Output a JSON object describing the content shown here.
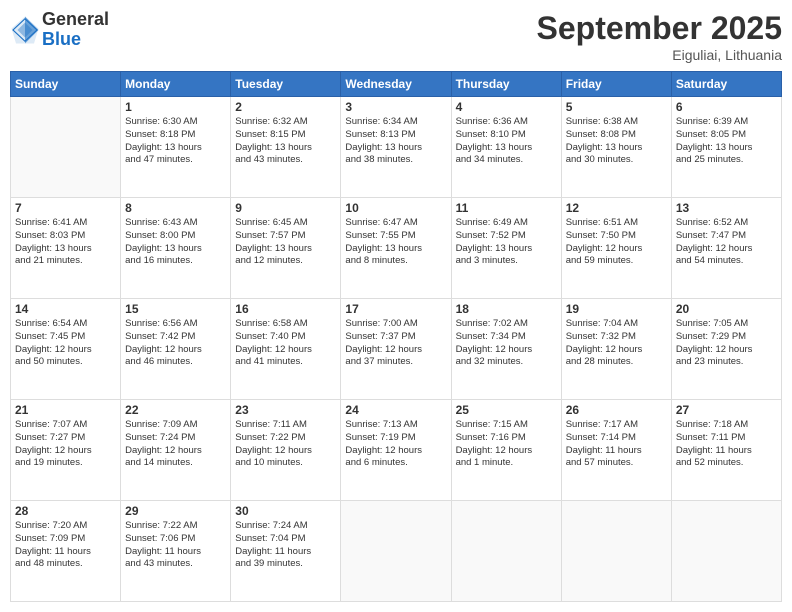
{
  "header": {
    "logo_general": "General",
    "logo_blue": "Blue",
    "month_title": "September 2025",
    "location": "Eiguliai, Lithuania"
  },
  "days_of_week": [
    "Sunday",
    "Monday",
    "Tuesday",
    "Wednesday",
    "Thursday",
    "Friday",
    "Saturday"
  ],
  "weeks": [
    [
      {
        "day": "",
        "info": ""
      },
      {
        "day": "1",
        "info": "Sunrise: 6:30 AM\nSunset: 8:18 PM\nDaylight: 13 hours\nand 47 minutes."
      },
      {
        "day": "2",
        "info": "Sunrise: 6:32 AM\nSunset: 8:15 PM\nDaylight: 13 hours\nand 43 minutes."
      },
      {
        "day": "3",
        "info": "Sunrise: 6:34 AM\nSunset: 8:13 PM\nDaylight: 13 hours\nand 38 minutes."
      },
      {
        "day": "4",
        "info": "Sunrise: 6:36 AM\nSunset: 8:10 PM\nDaylight: 13 hours\nand 34 minutes."
      },
      {
        "day": "5",
        "info": "Sunrise: 6:38 AM\nSunset: 8:08 PM\nDaylight: 13 hours\nand 30 minutes."
      },
      {
        "day": "6",
        "info": "Sunrise: 6:39 AM\nSunset: 8:05 PM\nDaylight: 13 hours\nand 25 minutes."
      }
    ],
    [
      {
        "day": "7",
        "info": "Sunrise: 6:41 AM\nSunset: 8:03 PM\nDaylight: 13 hours\nand 21 minutes."
      },
      {
        "day": "8",
        "info": "Sunrise: 6:43 AM\nSunset: 8:00 PM\nDaylight: 13 hours\nand 16 minutes."
      },
      {
        "day": "9",
        "info": "Sunrise: 6:45 AM\nSunset: 7:57 PM\nDaylight: 13 hours\nand 12 minutes."
      },
      {
        "day": "10",
        "info": "Sunrise: 6:47 AM\nSunset: 7:55 PM\nDaylight: 13 hours\nand 8 minutes."
      },
      {
        "day": "11",
        "info": "Sunrise: 6:49 AM\nSunset: 7:52 PM\nDaylight: 13 hours\nand 3 minutes."
      },
      {
        "day": "12",
        "info": "Sunrise: 6:51 AM\nSunset: 7:50 PM\nDaylight: 12 hours\nand 59 minutes."
      },
      {
        "day": "13",
        "info": "Sunrise: 6:52 AM\nSunset: 7:47 PM\nDaylight: 12 hours\nand 54 minutes."
      }
    ],
    [
      {
        "day": "14",
        "info": "Sunrise: 6:54 AM\nSunset: 7:45 PM\nDaylight: 12 hours\nand 50 minutes."
      },
      {
        "day": "15",
        "info": "Sunrise: 6:56 AM\nSunset: 7:42 PM\nDaylight: 12 hours\nand 46 minutes."
      },
      {
        "day": "16",
        "info": "Sunrise: 6:58 AM\nSunset: 7:40 PM\nDaylight: 12 hours\nand 41 minutes."
      },
      {
        "day": "17",
        "info": "Sunrise: 7:00 AM\nSunset: 7:37 PM\nDaylight: 12 hours\nand 37 minutes."
      },
      {
        "day": "18",
        "info": "Sunrise: 7:02 AM\nSunset: 7:34 PM\nDaylight: 12 hours\nand 32 minutes."
      },
      {
        "day": "19",
        "info": "Sunrise: 7:04 AM\nSunset: 7:32 PM\nDaylight: 12 hours\nand 28 minutes."
      },
      {
        "day": "20",
        "info": "Sunrise: 7:05 AM\nSunset: 7:29 PM\nDaylight: 12 hours\nand 23 minutes."
      }
    ],
    [
      {
        "day": "21",
        "info": "Sunrise: 7:07 AM\nSunset: 7:27 PM\nDaylight: 12 hours\nand 19 minutes."
      },
      {
        "day": "22",
        "info": "Sunrise: 7:09 AM\nSunset: 7:24 PM\nDaylight: 12 hours\nand 14 minutes."
      },
      {
        "day": "23",
        "info": "Sunrise: 7:11 AM\nSunset: 7:22 PM\nDaylight: 12 hours\nand 10 minutes."
      },
      {
        "day": "24",
        "info": "Sunrise: 7:13 AM\nSunset: 7:19 PM\nDaylight: 12 hours\nand 6 minutes."
      },
      {
        "day": "25",
        "info": "Sunrise: 7:15 AM\nSunset: 7:16 PM\nDaylight: 12 hours\nand 1 minute."
      },
      {
        "day": "26",
        "info": "Sunrise: 7:17 AM\nSunset: 7:14 PM\nDaylight: 11 hours\nand 57 minutes."
      },
      {
        "day": "27",
        "info": "Sunrise: 7:18 AM\nSunset: 7:11 PM\nDaylight: 11 hours\nand 52 minutes."
      }
    ],
    [
      {
        "day": "28",
        "info": "Sunrise: 7:20 AM\nSunset: 7:09 PM\nDaylight: 11 hours\nand 48 minutes."
      },
      {
        "day": "29",
        "info": "Sunrise: 7:22 AM\nSunset: 7:06 PM\nDaylight: 11 hours\nand 43 minutes."
      },
      {
        "day": "30",
        "info": "Sunrise: 7:24 AM\nSunset: 7:04 PM\nDaylight: 11 hours\nand 39 minutes."
      },
      {
        "day": "",
        "info": ""
      },
      {
        "day": "",
        "info": ""
      },
      {
        "day": "",
        "info": ""
      },
      {
        "day": "",
        "info": ""
      }
    ]
  ]
}
